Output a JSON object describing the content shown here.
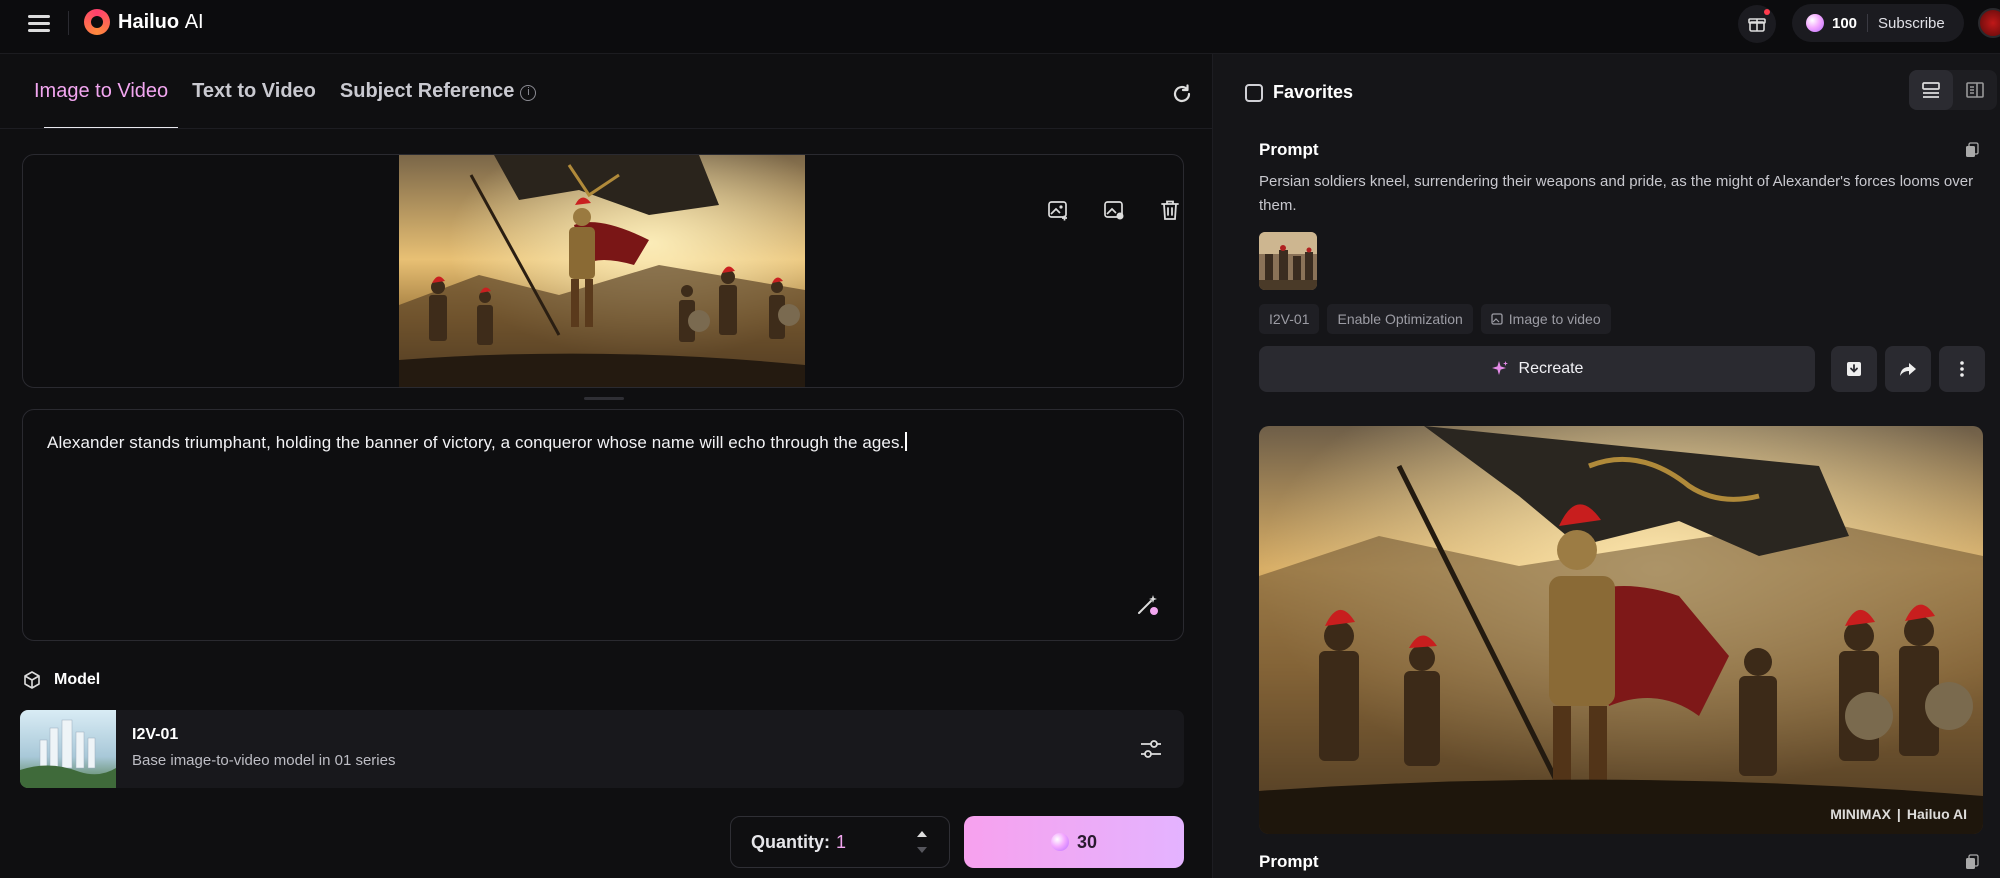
{
  "app": {
    "brand": "Hailuo",
    "brand_suffix": "AI",
    "credits": "100",
    "subscribe_label": "Subscribe"
  },
  "tabs": [
    {
      "label": "Image to Video",
      "active": true
    },
    {
      "label": "Text to Video",
      "active": false
    },
    {
      "label": "Subject Reference",
      "active": false
    }
  ],
  "composer": {
    "prompt": "Alexander stands triumphant, holding the banner of victory, a conqueror whose name will echo through the ages."
  },
  "model": {
    "heading": "Model",
    "name": "I2V-01",
    "description": "Base image-to-video model in 01 series"
  },
  "generate": {
    "quantity_label": "Quantity:",
    "quantity_value": "1",
    "cost": "30"
  },
  "history": {
    "favorites_label": "Favorites",
    "prompt_label": "Prompt",
    "prompt_text": "Persian soldiers kneel, surrendering their weapons and pride, as the might of Alexander's forces looms over them.",
    "tags": [
      "I2V-01",
      "Enable Optimization",
      "Image to video"
    ],
    "recreate_label": "Recreate",
    "watermark_left": "MINIMAX",
    "watermark_right": "Hailuo AI",
    "next_prompt_label": "Prompt"
  },
  "colors": {
    "accent": "#f2a6f0",
    "background": "#0f0f11",
    "panel": "#151518"
  }
}
